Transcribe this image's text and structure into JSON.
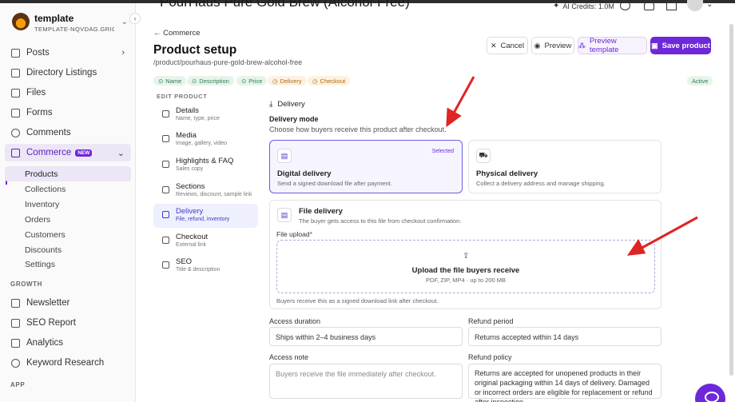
{
  "workspace": {
    "name": "template",
    "subtitle": "TEMPLATE-NQVDAG.GRIGOR..."
  },
  "header": {
    "heading": "PourHaus Pure Gold Brew (Alcohol-Free)",
    "ai_credits": "AI Credits: 1.0M"
  },
  "sidebar": {
    "items": [
      {
        "label": "Posts",
        "icon": "document-icon"
      },
      {
        "label": "Directory Listings",
        "icon": "list-icon"
      },
      {
        "label": "Files",
        "icon": "folder-icon"
      },
      {
        "label": "Forms",
        "icon": "form-icon"
      },
      {
        "label": "Comments",
        "icon": "comment-icon"
      },
      {
        "label": "Commerce",
        "icon": "cart-icon",
        "badge": "NEW"
      }
    ],
    "commerce_sub": [
      "Products",
      "Collections",
      "Inventory",
      "Orders",
      "Customers",
      "Discounts",
      "Settings"
    ],
    "growth_label": "GROWTH",
    "growth_items": [
      {
        "label": "Newsletter",
        "icon": "mail-icon"
      },
      {
        "label": "SEO Report",
        "icon": "report-icon"
      },
      {
        "label": "Analytics",
        "icon": "analytics-icon"
      },
      {
        "label": "Keyword Research",
        "icon": "search-icon"
      }
    ],
    "app_label": "APP"
  },
  "page": {
    "back": "Commerce",
    "title": "Product setup",
    "path": "/product/pourhaus-pure-gold-brew-alcohol-free",
    "actions": {
      "cancel": "Cancel",
      "preview": "Preview",
      "preview_template": "Preview template",
      "save": "Save product"
    },
    "chips": [
      {
        "label": "Name",
        "state": "ok"
      },
      {
        "label": "Description",
        "state": "ok"
      },
      {
        "label": "Price",
        "state": "ok"
      },
      {
        "label": "Delivery",
        "state": "warn"
      },
      {
        "label": "Checkout",
        "state": "warn"
      }
    ],
    "status": "Active"
  },
  "steps": {
    "label": "EDIT PRODUCT",
    "items": [
      {
        "title": "Details",
        "sub": "Name, type, price"
      },
      {
        "title": "Media",
        "sub": "Image, gallery, video"
      },
      {
        "title": "Highlights & FAQ",
        "sub": "Sales copy"
      },
      {
        "title": "Sections",
        "sub": "Reviews, discount, sample link"
      },
      {
        "title": "Delivery",
        "sub": "File, refund, inventory"
      },
      {
        "title": "Checkout",
        "sub": "External link"
      },
      {
        "title": "SEO",
        "sub": "Title & description"
      }
    ]
  },
  "delivery": {
    "section": "Delivery",
    "mode_label": "Delivery mode",
    "mode_help": "Choose how buyers receive this product after checkout.",
    "digital": {
      "title": "Digital delivery",
      "sub": "Send a signed download file after payment.",
      "selected": "Selected"
    },
    "physical": {
      "title": "Physical delivery",
      "sub": "Collect a delivery address and manage shipping."
    },
    "file": {
      "title": "File delivery",
      "sub": "The buyer gets access to this file from checkout confirmation.",
      "upload_label": "File upload",
      "required_mark": "*",
      "upload_title": "Upload the file buyers receive",
      "upload_sub": "PDF, ZIP, MP4 · up to 200 MB",
      "note": "Buyers receive this as a signed download link after checkout."
    },
    "access_duration": {
      "label": "Access duration",
      "value": "Ships within 2–4 business days"
    },
    "refund_period": {
      "label": "Refund period",
      "value": "Returns accepted within 14 days"
    },
    "access_note": {
      "label": "Access note",
      "placeholder": "Buyers receive the file immediately after checkout."
    },
    "refund_policy": {
      "label": "Refund policy",
      "value": "Returns are accepted for unopened products in their original packaging within 14 days of delivery. Damaged or incorrect orders are eligible for replacement or refund after inspection."
    }
  },
  "colors": {
    "accent": "#6d28d9",
    "annotation_arrow": "#e02424"
  }
}
